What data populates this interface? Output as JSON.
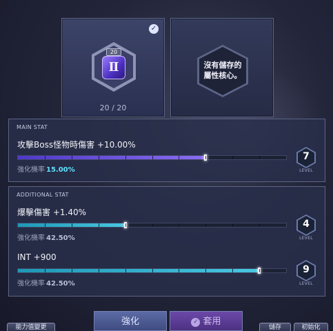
{
  "cores": {
    "equipped": {
      "level_badge": "20",
      "glyph": "Ⅱ",
      "count": "20 / 20",
      "check_icon": "check-circle-icon"
    },
    "empty_slot_text_line1": "沒有儲存的",
    "empty_slot_text_line2": "屬性核心。"
  },
  "main_stat": {
    "section_title": "MAIN STAT",
    "name": "攻擊Boss怪物時傷害 +10.00%",
    "progress": 0.7,
    "rate_label": "強化機率",
    "rate_value": "15.00%",
    "level": "7",
    "level_label": "LEVEL"
  },
  "additional_stats": {
    "section_title": "ADDITIONAL STAT",
    "items": [
      {
        "name": "爆擊傷害 +1.40%",
        "progress": 0.4,
        "rate_label": "強化機率",
        "rate_value": "42.50%",
        "level": "4",
        "level_label": "LEVEL"
      },
      {
        "name": "INT +900",
        "progress": 0.9,
        "rate_label": "強化機率",
        "rate_value": "42.50%",
        "level": "9",
        "level_label": "LEVEL"
      }
    ]
  },
  "buttons": {
    "enhance": "強化",
    "apply": "套用",
    "reset_stats": "能力值變更",
    "save": "儲存",
    "init": "初始化"
  }
}
